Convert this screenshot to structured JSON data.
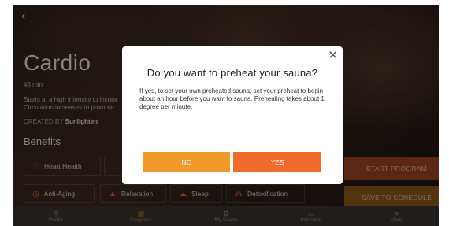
{
  "program": {
    "title": "Cardio",
    "duration": "45 min",
    "description_line1": "Starts at a high intensity to increa",
    "description_line2": "Circulation increases to promote",
    "created_prefix": "CREATED BY",
    "creator": "Sunlighten",
    "benefits_title": "Benefits",
    "benefits": [
      {
        "label": "Heart Health",
        "icon": "heart-icon"
      },
      {
        "label": "",
        "icon": "brain-icon"
      },
      {
        "label": "Anti-Aging",
        "icon": "clock-icon"
      },
      {
        "label": "Relaxation",
        "icon": "candle-icon"
      },
      {
        "label": "Sleep",
        "icon": "cloud-icon"
      },
      {
        "label": "Detoxification",
        "icon": "cells-icon"
      }
    ],
    "start_label": "START PROGRAM",
    "save_label": "SAVE TO SCHEDULE"
  },
  "tabs": [
    {
      "label": "Profile",
      "icon": "person-icon"
    },
    {
      "label": "Programs",
      "icon": "grid-icon"
    },
    {
      "label": "My Sauna",
      "icon": "gear-icon"
    },
    {
      "label": "Schedule",
      "icon": "calendar-icon"
    },
    {
      "label": "More",
      "icon": "menu-icon"
    }
  ],
  "dialog": {
    "title": "Do you want to preheat your sauna?",
    "body": "If yes, to set your own preheated sauna, set your preheat to begin about an hour before you want to sauna. Preheating takes about 1 degree per minute.",
    "no_label": "NO",
    "yes_label": "YES",
    "close": "✕"
  },
  "colors": {
    "accent_orange": "#ef6a2b",
    "no_button": "#f19a2c",
    "active_tab": "#a36a2f"
  }
}
